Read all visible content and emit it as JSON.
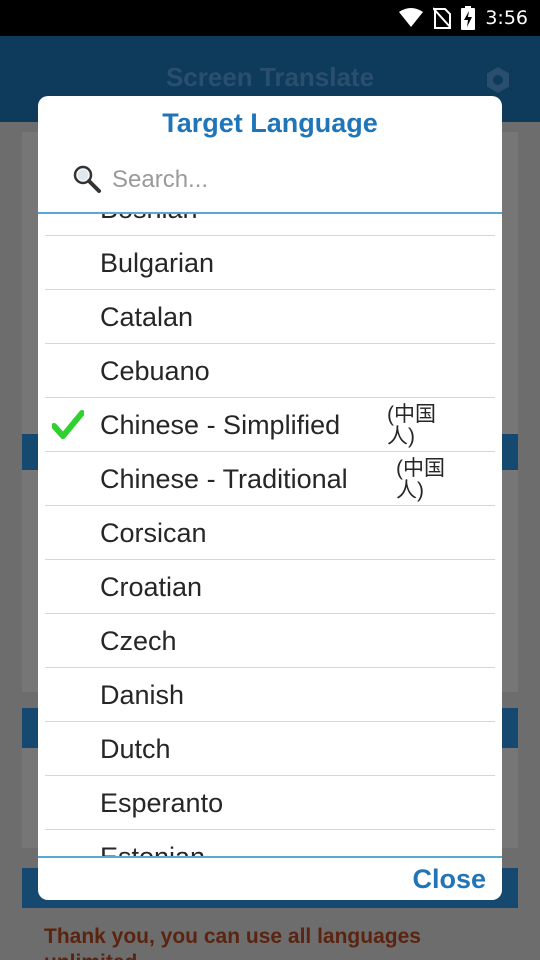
{
  "status_bar": {
    "time": "3:56",
    "icons": [
      "wifi-icon",
      "no-sim-icon",
      "battery-charging-icon"
    ]
  },
  "background_app": {
    "title": "Screen Translate",
    "settings_icon": "gear-icon",
    "notice": "Thank you, you can use all languages unlimited."
  },
  "dialog": {
    "title": "Target Language",
    "search": {
      "icon": "search-icon",
      "placeholder": "Search...",
      "value": ""
    },
    "languages": [
      {
        "name": "Bosnian",
        "native": "",
        "selected": false
      },
      {
        "name": "Bulgarian",
        "native": "",
        "selected": false
      },
      {
        "name": "Catalan",
        "native": "",
        "selected": false
      },
      {
        "name": "Cebuano",
        "native": "",
        "selected": false
      },
      {
        "name": "Chinese - Simplified",
        "native": "(中国人)",
        "selected": true
      },
      {
        "name": "Chinese - Traditional",
        "native": "(中国人)",
        "selected": false
      },
      {
        "name": "Corsican",
        "native": "",
        "selected": false
      },
      {
        "name": "Croatian",
        "native": "",
        "selected": false
      },
      {
        "name": "Czech",
        "native": "",
        "selected": false
      },
      {
        "name": "Danish",
        "native": "",
        "selected": false
      },
      {
        "name": "Dutch",
        "native": "",
        "selected": false
      },
      {
        "name": "Esperanto",
        "native": "",
        "selected": false
      },
      {
        "name": "Estonian",
        "native": "",
        "selected": false
      }
    ],
    "close_label": "Close"
  },
  "colors": {
    "accent": "#1f75b8",
    "check": "#2ed12e",
    "divider": "#5aa7d6"
  }
}
